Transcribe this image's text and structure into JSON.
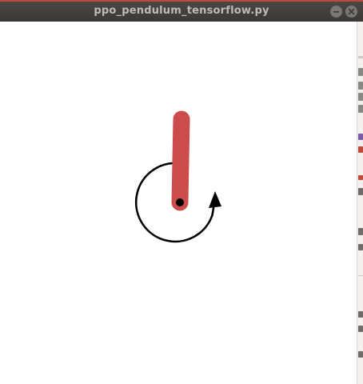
{
  "window": {
    "title": "ppo_pendulum_tensorflow.py",
    "buttons": {
      "minimize_icon": "minimize-icon",
      "close_icon": "close-icon"
    }
  },
  "colors": {
    "titlebar": "#3c3b37",
    "titlebar_accent": "#c04a3a",
    "title_text": "#bdbbb6",
    "pendulum_rod": "#cc4c4c",
    "pivot": "#000000",
    "torque_arrow": "#000000",
    "canvas_background": "#ffffff"
  },
  "scene": {
    "pendulum_icon": "pendulum-rod",
    "torque_icon": "clockwise-rotation-arrow-icon"
  }
}
